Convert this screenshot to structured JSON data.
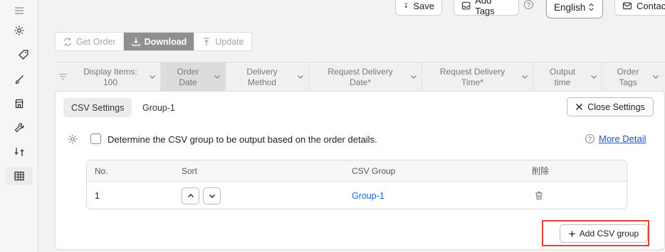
{
  "topbar": {
    "save_label": "Save",
    "add_tags_label": "Add Tags",
    "help_glyph": "?",
    "language": "English",
    "contact_label": "Contact"
  },
  "sidebar": {
    "items": [
      {
        "icon": "hamburger-icon"
      },
      {
        "icon": "gear-icon"
      },
      {
        "icon": "tag-icon"
      },
      {
        "icon": "brush-icon"
      },
      {
        "icon": "shop-icon"
      },
      {
        "icon": "wrench-icon"
      },
      {
        "icon": "sync-icon"
      },
      {
        "icon": "table-icon",
        "active": true
      }
    ]
  },
  "actions": {
    "get_order": "Get Order",
    "download": "Download",
    "update": "Update"
  },
  "columns": [
    {
      "label": "Display Items:",
      "sub": "100"
    },
    {
      "label": "Order",
      "sub": "Date",
      "active": true
    },
    {
      "label": "Delivery",
      "sub": "Method"
    },
    {
      "label": "Request Delivery",
      "sub": "Date*"
    },
    {
      "label": "Request Delivery",
      "sub": "Time*"
    },
    {
      "label": "Output",
      "sub": "time"
    },
    {
      "label": "Order",
      "sub": "Tags"
    }
  ],
  "panel": {
    "tabs": [
      {
        "label": "CSV Settings",
        "active": true
      },
      {
        "label": "Group-1"
      }
    ],
    "close_label": "Close Settings",
    "checkbox_label": "Determine the CSV group to be output based on the order details.",
    "checkbox_checked": false,
    "more_detail": "More Detail",
    "table": {
      "headers": {
        "no": "No.",
        "sort": "Sort",
        "group": "CSV Group",
        "delete": "削除"
      },
      "rows": [
        {
          "no": "1",
          "group": "Group-1"
        }
      ]
    },
    "add_label": "Add CSV group"
  },
  "colors": {
    "accent_link": "#1c6bd1",
    "highlight_box": "#e04232",
    "active_action_bg": "#8f8f8f"
  }
}
